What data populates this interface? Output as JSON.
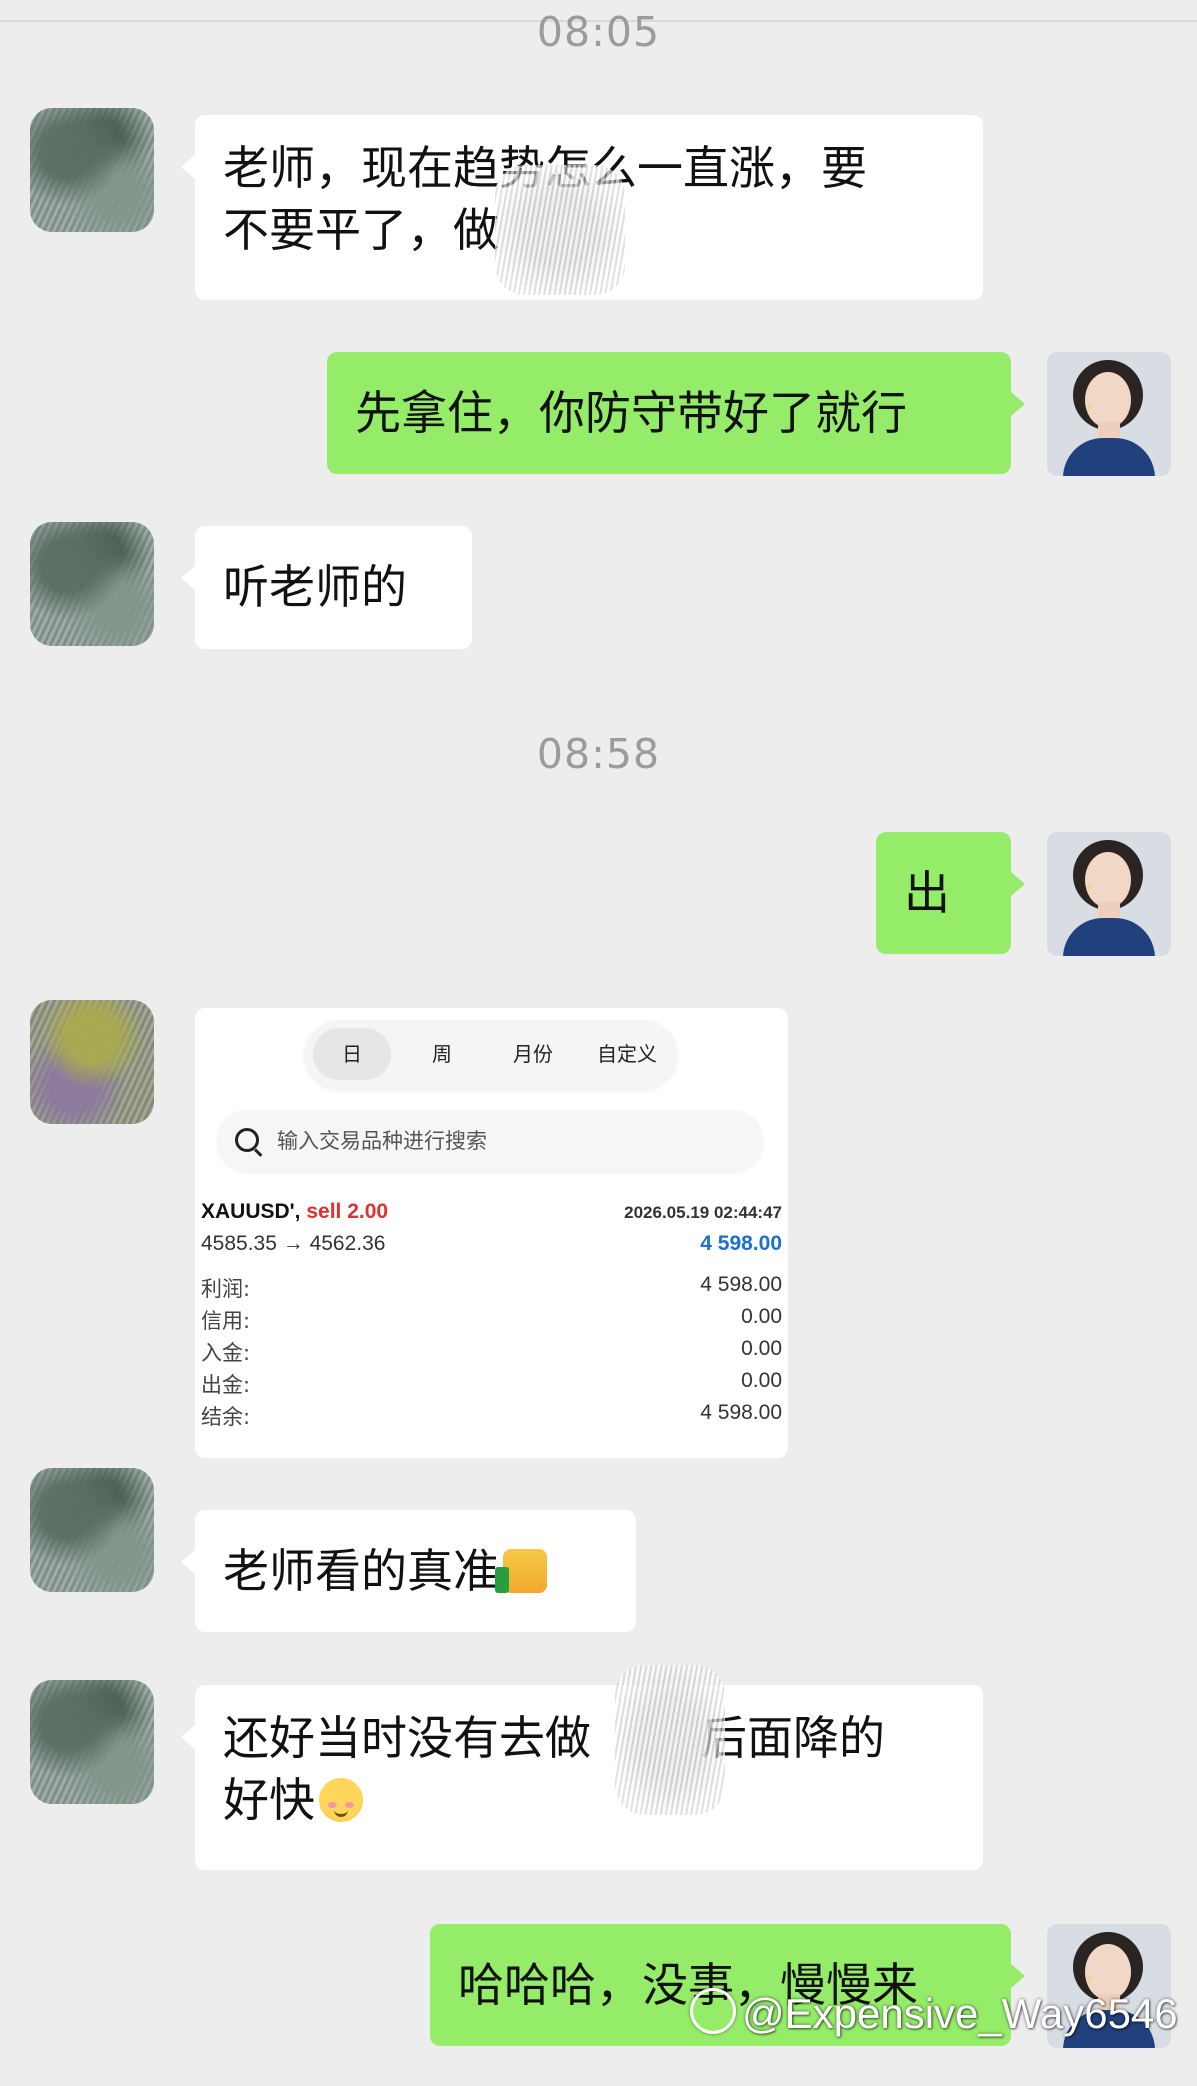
{
  "chat": {
    "time1": "08:05",
    "time2": "08:58",
    "messages": {
      "m1_line1": "老师，现在趋势怎么一直涨，要",
      "m1_line2": "不要平了，做",
      "m2": "先拿住，你防守带好了就行",
      "m3": "听老师的",
      "m4": "出",
      "m6": "老师看的真准",
      "m7_line1": "还好当时没有去做",
      "m7_line1b": "后面降的",
      "m7_line2": "好快",
      "m8": "哈哈哈，没事，慢慢来"
    }
  },
  "screenshot": {
    "tabs": [
      "日",
      "周",
      "月份",
      "自定义"
    ],
    "search_placeholder": "输入交易品种进行搜索",
    "symbol": "XAUUSD'",
    "side": "sell 2.00",
    "datetime": "2026.05.19 02:44:47",
    "prices": "4585.35 → 4562.36",
    "profit_value": "4 598.00",
    "rows": [
      {
        "label": "利润:",
        "value": "4 598.00"
      },
      {
        "label": "信用:",
        "value": "0.00"
      },
      {
        "label": "入金:",
        "value": "0.00"
      },
      {
        "label": "出金:",
        "value": "0.00"
      },
      {
        "label": "结余:",
        "value": "4 598.00"
      }
    ]
  },
  "icons": {
    "thumbs_up": "thumbs-up-emoji-icon",
    "smile": "smiling-face-emoji-icon",
    "search": "search-icon"
  },
  "watermark": "@Expensive_Way6546",
  "colors": {
    "background": "#ededed",
    "outgoing_bubble": "#95ec69",
    "incoming_bubble": "#ffffff",
    "sell": "#e0312f",
    "profit": "#1e6fd0"
  }
}
